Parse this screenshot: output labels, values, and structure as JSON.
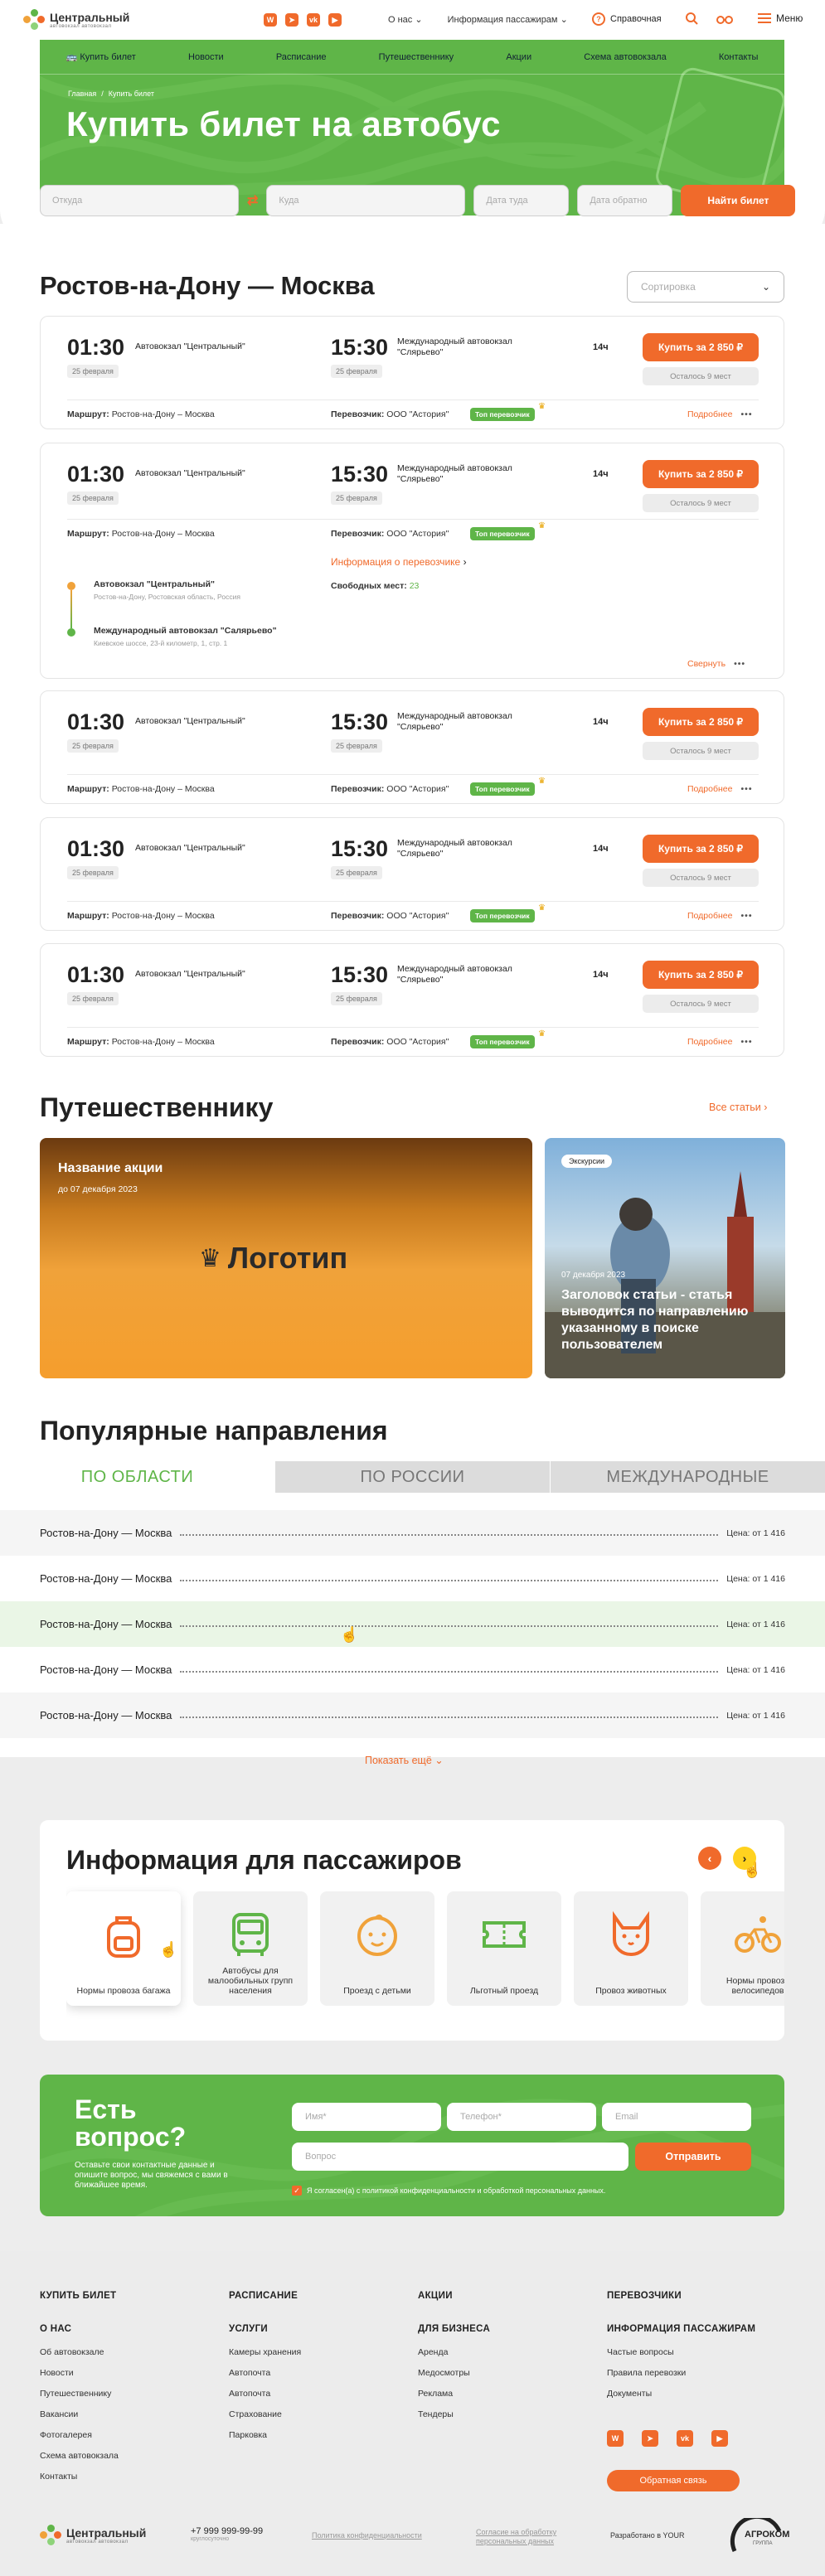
{
  "brand": {
    "name": "Центральный",
    "subtitle": "автовокзал автовокзал"
  },
  "header": {
    "socials": [
      "whatsapp-icon",
      "telegram-icon",
      "vk-icon",
      "youtube-icon"
    ],
    "menu": [
      "О нас",
      "Информация пассажирам"
    ],
    "help": "Справочная",
    "menu_button": "Меню"
  },
  "nav": {
    "items": [
      "Купить билет",
      "Новости",
      "Расписание",
      "Путешественнику",
      "Акции",
      "Схема автовокзала",
      "Контакты"
    ]
  },
  "breadcrumbs": [
    "Главная",
    "Купить билет"
  ],
  "hero": {
    "title": "Купить билет на автобус"
  },
  "search": {
    "from": "Откуда",
    "to": "Куда",
    "date_there": "Дата туда",
    "date_back": "Дата обратно",
    "button": "Найти билет"
  },
  "results": {
    "title": "Ростов-на-Дону — Москва",
    "sort_placeholder": "Сортировка",
    "trips": [
      {
        "dep_time": "01:30",
        "dep_station": "Автовокзал \"Центральный\"",
        "dep_date": "25 февраля",
        "arr_time": "15:30",
        "arr_station": "Международный автовокзал \"Слярьево\"",
        "arr_date": "25 февраля",
        "duration": "14ч",
        "buy": "Купить за 2 850 ₽",
        "seats_left": "Осталось 9 мест",
        "route_label": "Маршрут:",
        "route": "Ростов-на-Дону – Москва",
        "carrier_label": "Перевозчик:",
        "carrier": "ООО \"Астория\"",
        "badge": "Топ перевозчик",
        "more": "Подробнее"
      },
      {
        "dep_time": "01:30",
        "dep_station": "Автовокзал \"Центральный\"",
        "dep_date": "25 февраля",
        "arr_time": "15:30",
        "arr_station": "Международный автовокзал \"Слярьево\"",
        "arr_date": "25 февраля",
        "duration": "14ч",
        "buy": "Купить за 2 850 ₽",
        "seats_left": "Осталось 9 мест",
        "route_label": "Маршрут:",
        "route": "Ростов-на-Дону – Москва",
        "carrier_label": "Перевозчик:",
        "carrier": "ООО \"Астория\"",
        "badge": "Топ перевозчик",
        "more": "Свернуть",
        "carrier_info": "Информация о перевозчике",
        "free_seats_label": "Свободных мест:",
        "free_seats": "23",
        "stop1_name": "Автовокзал \"Центральный\"",
        "stop1_addr": "Ростов-на-Дону, Ростовская область, Россия",
        "stop2_name": "Международный автовокзал \"Салярьево\"",
        "stop2_addr": "Киевское шоссе, 23-й километр, 1, стр. 1"
      },
      {
        "dep_time": "01:30",
        "dep_station": "Автовокзал \"Центральный\"",
        "dep_date": "25 февраля",
        "arr_time": "15:30",
        "arr_station": "Международный автовокзал \"Слярьево\"",
        "arr_date": "25 февраля",
        "duration": "14ч",
        "buy": "Купить за 2 850 ₽",
        "seats_left": "Осталось 9 мест",
        "route_label": "Маршрут:",
        "route": "Ростов-на-Дону – Москва",
        "carrier_label": "Перевозчик:",
        "carrier": "ООО \"Астория\"",
        "badge": "Топ перевозчик",
        "more": "Подробнее"
      },
      {
        "dep_time": "01:30",
        "dep_station": "Автовокзал \"Центральный\"",
        "dep_date": "25 февраля",
        "arr_time": "15:30",
        "arr_station": "Международный автовокзал \"Слярьево\"",
        "arr_date": "25 февраля",
        "duration": "14ч",
        "buy": "Купить за 2 850 ₽",
        "seats_left": "Осталось 9 мест",
        "route_label": "Маршрут:",
        "route": "Ростов-на-Дону – Москва",
        "carrier_label": "Перевозчик:",
        "carrier": "ООО \"Астория\"",
        "badge": "Топ перевозчик",
        "more": "Подробнее"
      },
      {
        "dep_time": "01:30",
        "dep_station": "Автовокзал \"Центральный\"",
        "dep_date": "25 февраля",
        "arr_time": "15:30",
        "arr_station": "Международный автовокзал \"Слярьево\"",
        "arr_date": "25 февраля",
        "duration": "14ч",
        "buy": "Купить за 2 850 ₽",
        "seats_left": "Осталось 9 мест",
        "route_label": "Маршрут:",
        "route": "Ростов-на-Дону – Москва",
        "carrier_label": "Перевозчик:",
        "carrier": "ООО \"Астория\"",
        "badge": "Топ перевозчик",
        "more": "Подробнее"
      }
    ]
  },
  "traveler": {
    "title": "Путешественнику",
    "all_link": "Все статьи",
    "promo": {
      "title": "Название акции",
      "date": "до 07 декабря 2023",
      "logo": "Логотип"
    },
    "article": {
      "tag": "Экскурсии",
      "date": "07 декабря 2023",
      "title": "Заголовок статьи - статья выводится по направлению указанному в поиске пользователем"
    }
  },
  "popular": {
    "title": "Популярные направления",
    "tabs": [
      "ПО ОБЛАСТИ",
      "ПО РОССИИ",
      "МЕЖДУНАРОДНЫЕ"
    ],
    "rows": [
      {
        "name": "Ростов-на-Дону — Москва",
        "price": "Цена: от 1 416"
      },
      {
        "name": "Ростов-на-Дону — Москва",
        "price": "Цена: от 1 416"
      },
      {
        "name": "Ростов-на-Дону — Москва",
        "price": "Цена: от 1 416"
      },
      {
        "name": "Ростов-на-Дону — Москва",
        "price": "Цена: от 1 416"
      },
      {
        "name": "Ростов-на-Дону — Москва",
        "price": "Цена: от 1 416"
      }
    ],
    "show_more": "Показать ещё"
  },
  "passenger_info": {
    "title": "Информация для пассажиров",
    "cards": [
      {
        "label": "Нормы провоза багажа",
        "icon": "backpack-icon"
      },
      {
        "label": "Автобусы для малообильных групп населения",
        "icon": "bus-icon"
      },
      {
        "label": "Проезд с детьми",
        "icon": "child-icon"
      },
      {
        "label": "Льготный проезд",
        "icon": "ticket-icon"
      },
      {
        "label": "Провоз животных",
        "icon": "cat-icon"
      },
      {
        "label": "Нормы провоза велосипедов",
        "icon": "bicycle-icon"
      }
    ]
  },
  "question": {
    "title_line1": "Есть",
    "title_line2": "вопрос?",
    "text": "Оставьте свои контактные данные и опишите вопрос, мы свяжемся с вами в ближайшее время.",
    "name": "Имя*",
    "phone": "Телефон*",
    "email": "Email",
    "message": "Вопрос",
    "submit": "Отправить",
    "consent": "Я согласен(а) с политикой конфиденциальности и обработкой персональных данных."
  },
  "footer": {
    "col1": {
      "h1": "КУПИТЬ БИЛЕТ",
      "h2": "О НАС",
      "links": [
        "Об автовокзале",
        "Новости",
        "Путешественнику",
        "Вакансии",
        "Фотогалерея",
        "Схема автовокзала",
        "Контакты"
      ]
    },
    "col2": {
      "h1": "РАСПИСАНИЕ",
      "h2": "УСЛУГИ",
      "links": [
        "Камеры хранения",
        "Автопочта",
        "Автопочта",
        "Страхование",
        "Парковка"
      ]
    },
    "col3": {
      "h1": "АКЦИИ",
      "h2": "ДЛЯ БИЗНЕСА",
      "links": [
        "Аренда",
        "Медосмотры",
        "Реклама",
        "Тендеры"
      ]
    },
    "col4": {
      "h1": "ПЕРЕВОЗЧИКИ",
      "h2": "ИНФОРМАЦИЯ ПАССАЖИРАМ",
      "links": [
        "Частые вопросы",
        "Правила перевозки",
        "Документы"
      ]
    },
    "feedback": "Обратная связь",
    "phone": "+7 999 999-99-99",
    "phone_note": "круглосуточно",
    "privacy": "Политика конфиденциальности",
    "consent": "Согласие на обработку персональных данных",
    "dev": "Разработано в YOUR",
    "agency": "АГРОКОМ",
    "agency_sub": "ГРУППА"
  },
  "colors": {
    "accent": "#f06a2b",
    "green": "#5fb548",
    "bg": "#ededed"
  }
}
